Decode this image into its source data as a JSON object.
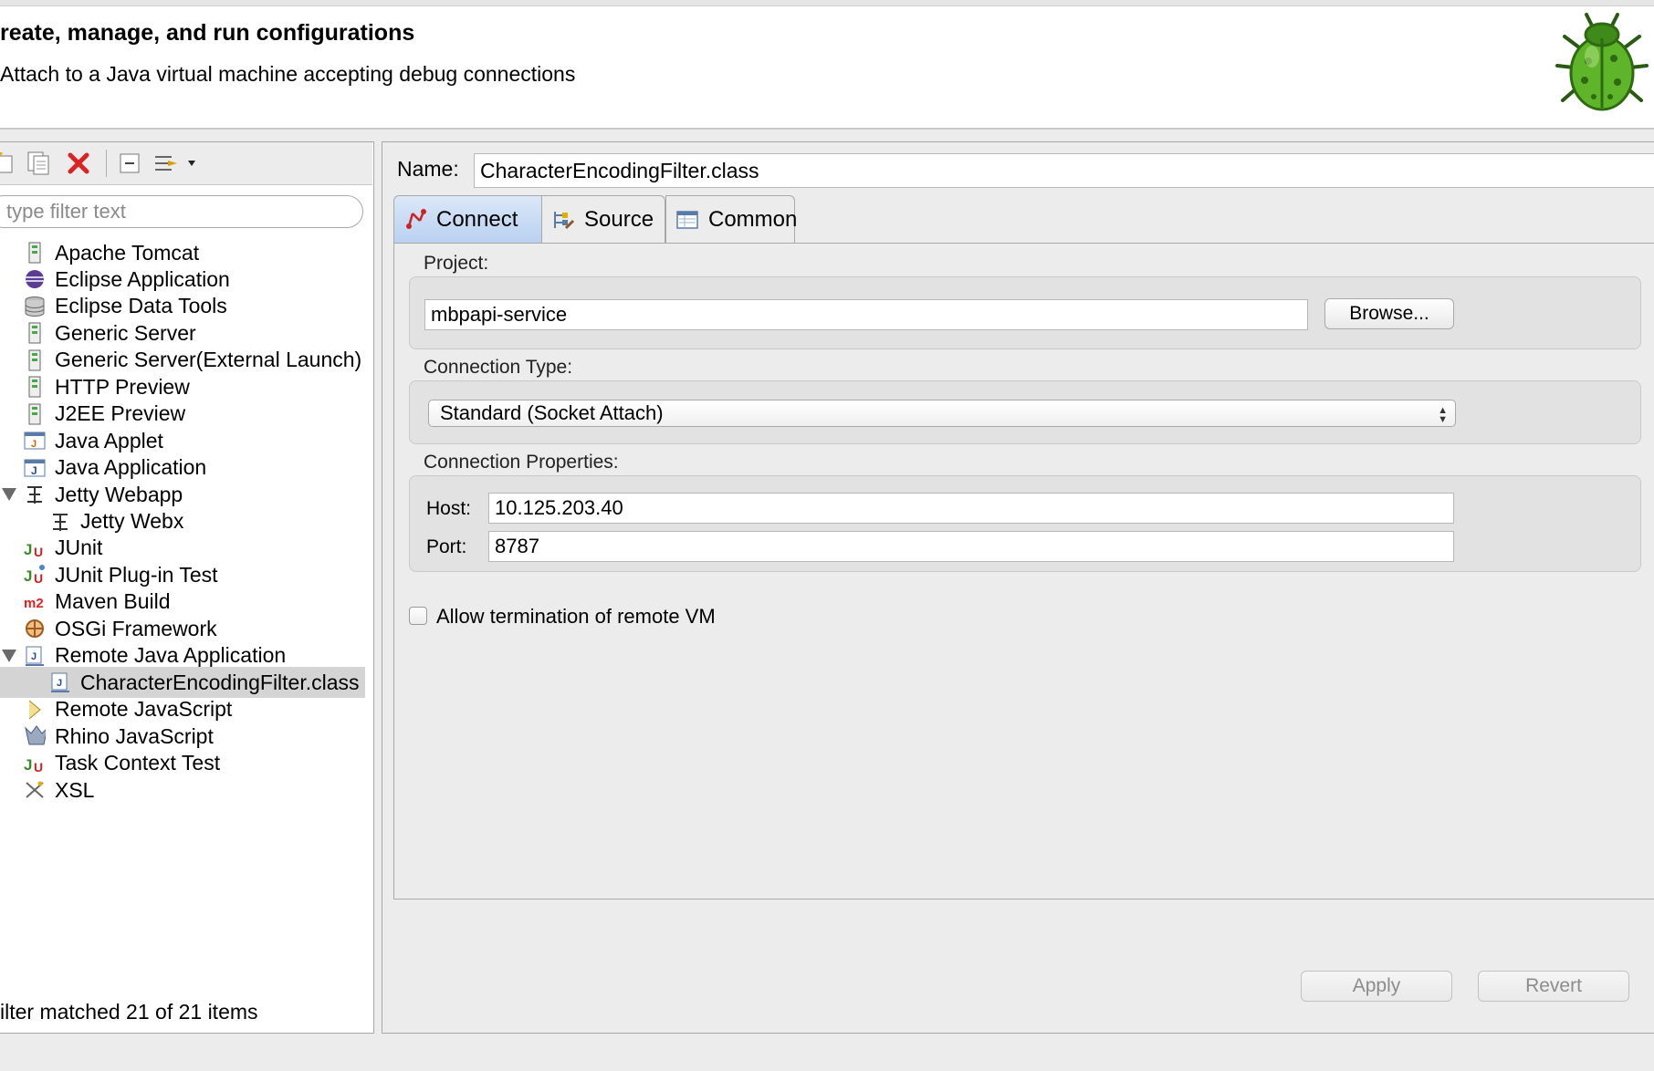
{
  "header": {
    "title": "reate, manage, and run configurations",
    "description": "Attach to a Java virtual machine accepting debug connections",
    "logo_icon": "debug-bug-icon"
  },
  "left": {
    "toolbar": [
      "new-configuration-icon",
      "duplicate-icon",
      "delete-icon",
      "collapse-all-icon",
      "filter-menu-icon"
    ],
    "filter_placeholder": "type filter text",
    "tree": [
      {
        "label": "Apache Tomcat",
        "icon": "server-icon",
        "depth": 0
      },
      {
        "label": "Eclipse Application",
        "icon": "eclipse-icon",
        "depth": 0
      },
      {
        "label": "Eclipse Data Tools",
        "icon": "database-icon",
        "depth": 0
      },
      {
        "label": "Generic Server",
        "icon": "server-icon",
        "depth": 0
      },
      {
        "label": "Generic Server(External Launch)",
        "icon": "server-icon",
        "depth": 0
      },
      {
        "label": "HTTP Preview",
        "icon": "server-icon",
        "depth": 0
      },
      {
        "label": "J2EE Preview",
        "icon": "server-icon",
        "depth": 0
      },
      {
        "label": "Java Applet",
        "icon": "java-applet-icon",
        "depth": 0
      },
      {
        "label": "Java Application",
        "icon": "java-application-icon",
        "depth": 0
      },
      {
        "label": "Jetty Webapp",
        "icon": "jetty-icon",
        "depth": 0,
        "expanded": true
      },
      {
        "label": "Jetty Webx",
        "icon": "jetty-icon",
        "depth": 1
      },
      {
        "label": "JUnit",
        "icon": "junit-icon",
        "depth": 0
      },
      {
        "label": "JUnit Plug-in Test",
        "icon": "junit-plugin-icon",
        "depth": 0
      },
      {
        "label": "Maven Build",
        "icon": "maven-icon",
        "depth": 0
      },
      {
        "label": "OSGi Framework",
        "icon": "osgi-icon",
        "depth": 0
      },
      {
        "label": "Remote Java Application",
        "icon": "remote-java-icon",
        "depth": 0,
        "expanded": true
      },
      {
        "label": "CharacterEncodingFilter.class",
        "icon": "remote-java-icon",
        "depth": 1,
        "selected": true
      },
      {
        "label": "Remote JavaScript",
        "icon": "remote-javascript-icon",
        "depth": 0
      },
      {
        "label": "Rhino JavaScript",
        "icon": "rhino-icon",
        "depth": 0
      },
      {
        "label": "Task Context Test",
        "icon": "junit-icon",
        "depth": 0
      },
      {
        "label": "XSL",
        "icon": "xsl-icon",
        "depth": 0
      }
    ],
    "filter_status": "ilter matched 21 of 21 items"
  },
  "right": {
    "name_label": "Name:",
    "name_value": "CharacterEncodingFilter.class",
    "tabs": [
      {
        "label": "Connect",
        "icon": "connect-icon",
        "active": true
      },
      {
        "label": "Source",
        "icon": "source-icon",
        "active": false
      },
      {
        "label": "Common",
        "icon": "common-icon",
        "active": false
      }
    ],
    "project": {
      "label": "Project:",
      "value": "mbpapi-service",
      "browse_label": "Browse..."
    },
    "connection_type": {
      "label": "Connection Type:",
      "value": "Standard (Socket Attach)"
    },
    "connection_properties": {
      "label": "Connection Properties:",
      "host_label": "Host:",
      "host_value": "10.125.203.40",
      "port_label": "Port:",
      "port_value": "8787"
    },
    "allow_termination": {
      "label": "Allow termination of remote VM",
      "checked": false
    },
    "apply_label": "Apply",
    "revert_label": "Revert"
  }
}
